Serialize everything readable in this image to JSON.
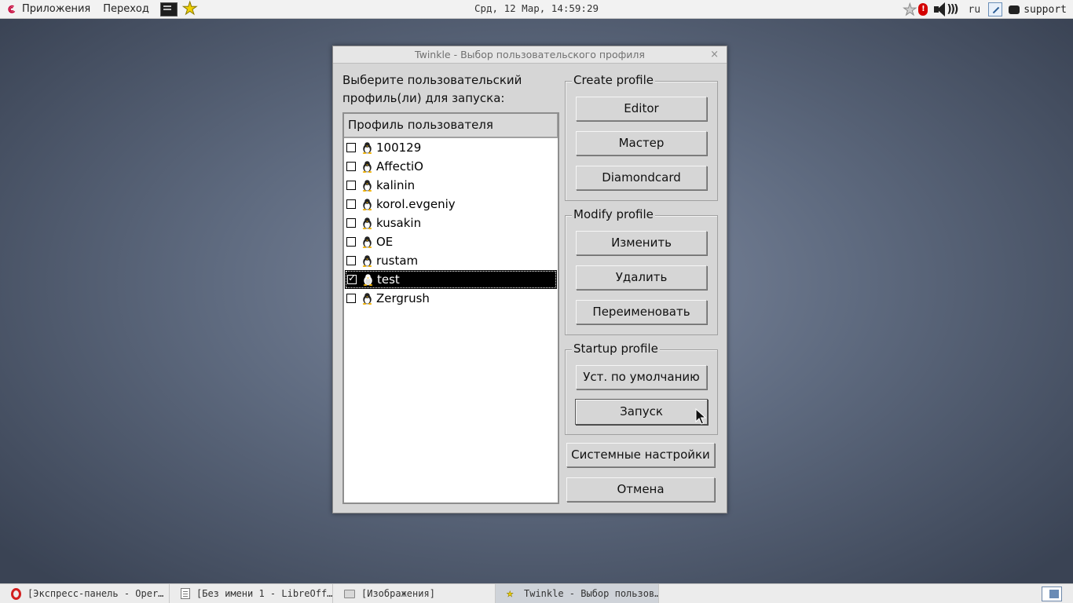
{
  "top_panel": {
    "apps_label": "Приложения",
    "go_label": "Переход",
    "clock": "Срд, 12 Мар, 14:59:29",
    "lang": "ru",
    "alert_badge": "!",
    "user": "support"
  },
  "dialog": {
    "title": "Twinkle - Выбор пользовательского профиля",
    "close_glyph": "×",
    "prompt_line1": "Выберите пользовательский",
    "prompt_line2": "профиль(ли) для запуска:",
    "list_header": "Профиль пользователя",
    "profiles": [
      {
        "name": "100129",
        "checked": false
      },
      {
        "name": "AffectiO",
        "checked": false
      },
      {
        "name": "kalinin",
        "checked": false
      },
      {
        "name": "korol.evgeniy",
        "checked": false
      },
      {
        "name": "kusakin",
        "checked": false
      },
      {
        "name": "OE",
        "checked": false
      },
      {
        "name": "rustam",
        "checked": false
      },
      {
        "name": "test",
        "checked": true
      },
      {
        "name": "Zergrush",
        "checked": false
      }
    ],
    "create_group": {
      "title": "Create profile",
      "editor": "Editor",
      "wizard": "Мастер",
      "diamondcard": "Diamondcard"
    },
    "modify_group": {
      "title": "Modify profile",
      "edit": "Изменить",
      "delete": "Удалить",
      "rename": "Переименовать"
    },
    "startup_group": {
      "title": "Startup profile",
      "set_default": "Уст. по умолчанию",
      "run": "Запуск"
    },
    "system_settings": "Системные настройки",
    "cancel": "Отмена"
  },
  "taskbar": {
    "tasks": [
      {
        "label": "[Экспресс-панель - Oper…",
        "icon": "opera-icon"
      },
      {
        "label": "[Без имени 1 - LibreOff…",
        "icon": "document-icon"
      },
      {
        "label": "[Изображения]",
        "icon": "folder-icon"
      },
      {
        "label": "Twinkle - Выбор пользов…",
        "icon": "star-icon",
        "active": true
      }
    ]
  },
  "colors": {
    "desktop": "#5f6b80",
    "dialog_bg": "#d6d6d6",
    "selection": "#000000",
    "panel": "#f2f2f2"
  }
}
